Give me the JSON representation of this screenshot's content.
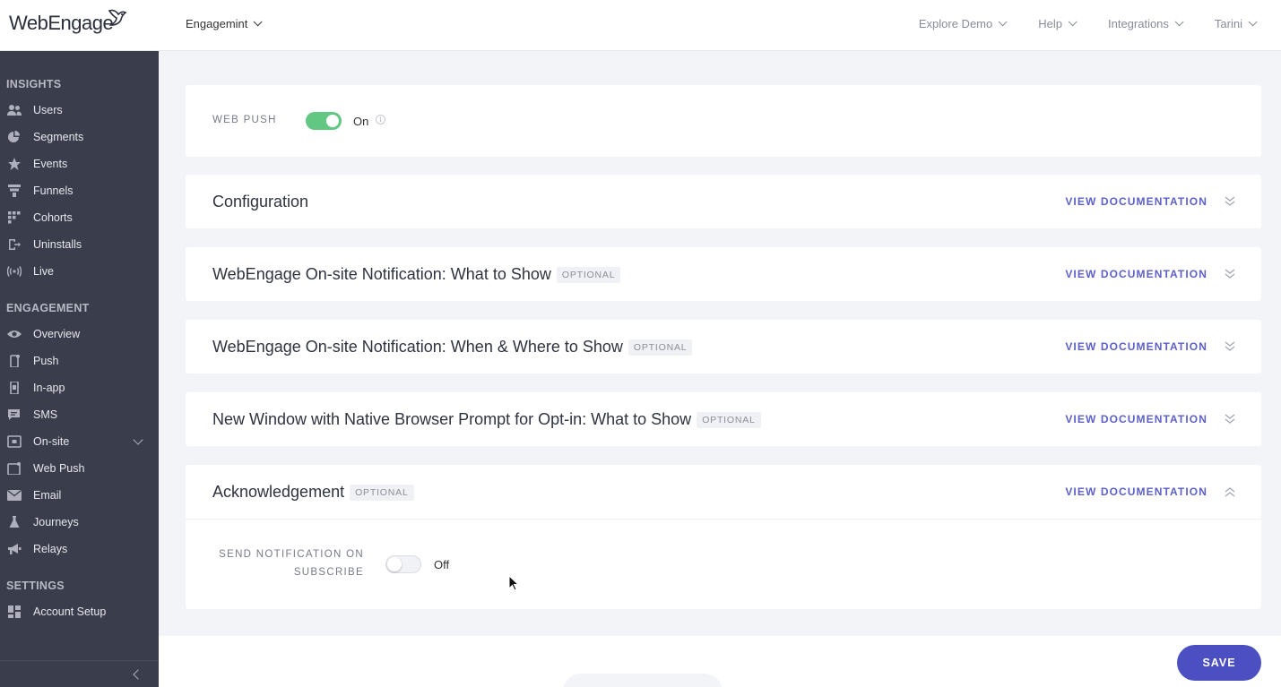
{
  "header": {
    "logo_text": "WebEngage",
    "project": "Engagemint",
    "nav": [
      {
        "label": "Explore Demo"
      },
      {
        "label": "Help"
      },
      {
        "label": "Integrations"
      },
      {
        "label": "Tarini"
      }
    ]
  },
  "sidebar": {
    "sections": [
      {
        "title": "INSIGHTS",
        "items": [
          {
            "label": "Users",
            "icon": "users-icon"
          },
          {
            "label": "Segments",
            "icon": "pie-chart-icon"
          },
          {
            "label": "Events",
            "icon": "star-icon"
          },
          {
            "label": "Funnels",
            "icon": "funnel-icon"
          },
          {
            "label": "Cohorts",
            "icon": "grid-icon"
          },
          {
            "label": "Uninstalls",
            "icon": "exit-icon"
          },
          {
            "label": "Live",
            "icon": "broadcast-icon"
          }
        ]
      },
      {
        "title": "ENGAGEMENT",
        "items": [
          {
            "label": "Overview",
            "icon": "eye-icon"
          },
          {
            "label": "Push",
            "icon": "mobile-icon"
          },
          {
            "label": "In-app",
            "icon": "phone-screen-icon"
          },
          {
            "label": "SMS",
            "icon": "chat-icon"
          },
          {
            "label": "On-site",
            "icon": "window-icon"
          },
          {
            "label": "Web Push",
            "icon": "browser-bell-icon"
          },
          {
            "label": "Email",
            "icon": "envelope-icon"
          },
          {
            "label": "Journeys",
            "icon": "flask-icon"
          },
          {
            "label": "Relays",
            "icon": "megaphone-icon"
          }
        ]
      },
      {
        "title": "SETTINGS",
        "items": [
          {
            "label": "Account Setup",
            "icon": "dashboard-icon"
          }
        ]
      }
    ]
  },
  "web_push": {
    "label": "WEB PUSH",
    "state": "On",
    "enabled": true
  },
  "sections": [
    {
      "title": "Configuration",
      "badge": "",
      "link": "VIEW DOCUMENTATION",
      "expanded": false
    },
    {
      "title": "WebEngage On-site Notification: What to Show",
      "badge": "OPTIONAL",
      "link": "VIEW DOCUMENTATION",
      "expanded": false
    },
    {
      "title": "WebEngage On-site Notification: When & Where to Show",
      "badge": "OPTIONAL",
      "link": "VIEW DOCUMENTATION",
      "expanded": false
    },
    {
      "title": "New Window with Native Browser Prompt for Opt-in: What to Show",
      "badge": "OPTIONAL",
      "link": "VIEW DOCUMENTATION",
      "expanded": false
    },
    {
      "title": "Acknowledgement",
      "badge": "OPTIONAL",
      "link": "VIEW DOCUMENTATION",
      "expanded": true
    }
  ],
  "acknowledgement": {
    "label_line1": "SEND NOTIFICATION ON",
    "label_line2": "SUBSCRIBE",
    "state": "Off",
    "enabled": false
  },
  "footer": {
    "save_label": "SAVE"
  },
  "colors": {
    "accent": "#4b4fc2",
    "toggle_on": "#61c783",
    "sidebar_bg": "#3a3e4c",
    "link": "#5c60c8"
  }
}
